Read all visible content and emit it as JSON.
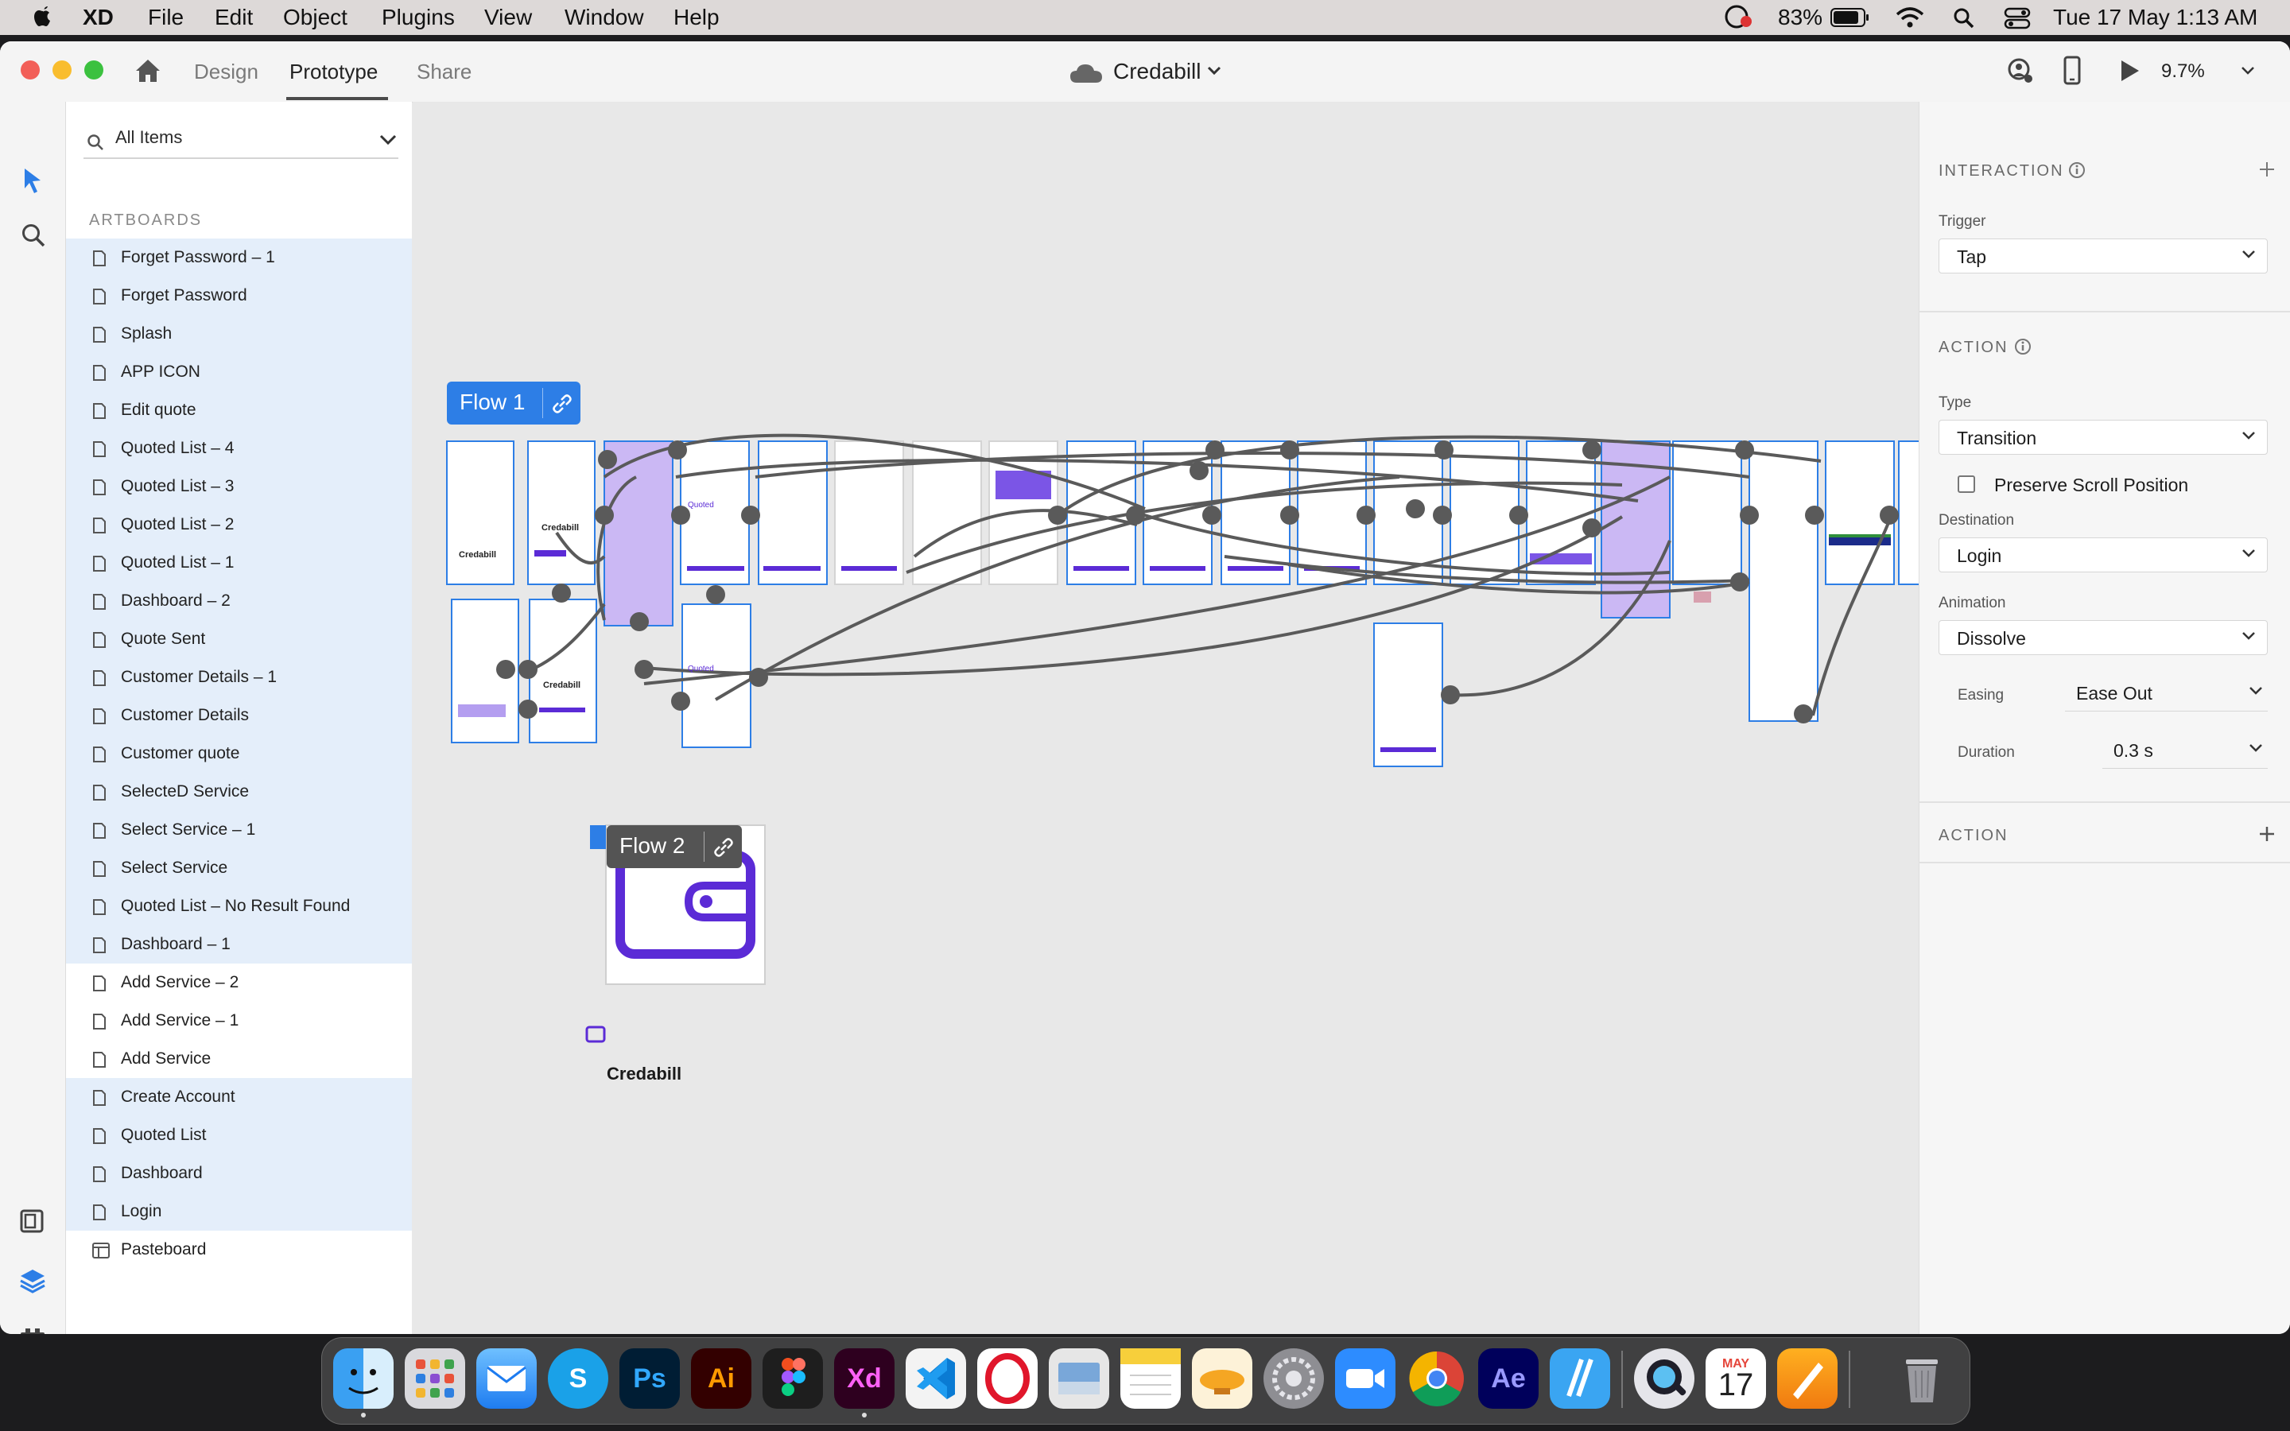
{
  "menubar": {
    "app_name": "XD",
    "menus": [
      "File",
      "Edit",
      "Object",
      "Plugins",
      "View",
      "Window",
      "Help"
    ],
    "battery_percent": "83%",
    "datetime": "Tue 17 May  1:13 AM"
  },
  "window": {
    "tabs": [
      "Design",
      "Prototype",
      "Share"
    ],
    "active_tab": "Prototype",
    "document_title": "Credabill",
    "zoom_level": "9.7%"
  },
  "layers_panel": {
    "search_label": "All Items",
    "section_title": "ARTBOARDS",
    "items": [
      {
        "label": "Forget Password – 1",
        "selected": true
      },
      {
        "label": "Forget Password",
        "selected": true
      },
      {
        "label": "Splash",
        "selected": true
      },
      {
        "label": "APP ICON",
        "selected": true
      },
      {
        "label": "Edit quote",
        "selected": true
      },
      {
        "label": "Quoted List – 4",
        "selected": true
      },
      {
        "label": "Quoted List – 3",
        "selected": true
      },
      {
        "label": "Quoted List – 2",
        "selected": true
      },
      {
        "label": "Quoted List – 1",
        "selected": true
      },
      {
        "label": "Dashboard – 2",
        "selected": true
      },
      {
        "label": "Quote Sent",
        "selected": true
      },
      {
        "label": "Customer Details – 1",
        "selected": true
      },
      {
        "label": "Customer Details",
        "selected": true
      },
      {
        "label": "Customer quote",
        "selected": true
      },
      {
        "label": "SelecteD Service",
        "selected": true
      },
      {
        "label": "Select Service – 1",
        "selected": true
      },
      {
        "label": "Select Service",
        "selected": true
      },
      {
        "label": "Quoted List – No Result Found",
        "selected": true
      },
      {
        "label": "Dashboard – 1",
        "selected": true
      },
      {
        "label": "Add Service – 2",
        "selected": false
      },
      {
        "label": "Add Service – 1",
        "selected": false
      },
      {
        "label": "Add Service",
        "selected": false
      },
      {
        "label": "Create Account",
        "selected": true
      },
      {
        "label": "Quoted List",
        "selected": true
      },
      {
        "label": "Dashboard",
        "selected": true
      },
      {
        "label": "Login",
        "selected": true
      },
      {
        "label": "Pasteboard",
        "selected": false
      }
    ]
  },
  "canvas": {
    "flow1_label": "Flow 1",
    "flow2_label": "Flow 2",
    "brand_label": "Credabill",
    "mini_brand": "Credabill",
    "mini_quoted": "Quoted"
  },
  "interaction_panel": {
    "interaction_heading": "INTERACTION",
    "trigger_label": "Trigger",
    "trigger_value": "Tap",
    "action_heading": "ACTION",
    "type_label": "Type",
    "type_value": "Transition",
    "preserve_scroll_label": "Preserve Scroll Position",
    "preserve_scroll_checked": false,
    "destination_label": "Destination",
    "destination_value": "Login",
    "animation_label": "Animation",
    "animation_value": "Dissolve",
    "easing_label": "Easing",
    "easing_value": "Ease Out",
    "duration_label": "Duration",
    "duration_value": "0.3 s",
    "action2_heading": "ACTION"
  },
  "dock": {
    "apps": [
      "Finder",
      "Launchpad",
      "Mail",
      "Skype",
      "Photoshop",
      "Illustrator",
      "Figma",
      "XD",
      "VS Code",
      "Opera",
      "Preview",
      "Notes",
      "Transmit",
      "System Preferences",
      "Zoom",
      "Chrome",
      "After Effects",
      "Toolbox",
      "QuickTime",
      "Calendar",
      "Pages",
      "Trash"
    ],
    "app_glyphs": {
      "skype": "S",
      "photoshop": "Ps",
      "illustrator": "Ai",
      "xd": "Xd",
      "after_effects": "Ae"
    },
    "calendar_month": "MAY",
    "calendar_day": "17"
  },
  "colors": {
    "accent_blue": "#2d7ee6",
    "brand_purple": "#5b2bd6",
    "connector": "#5a5a5a",
    "selection_fill": "#e4eefa"
  }
}
